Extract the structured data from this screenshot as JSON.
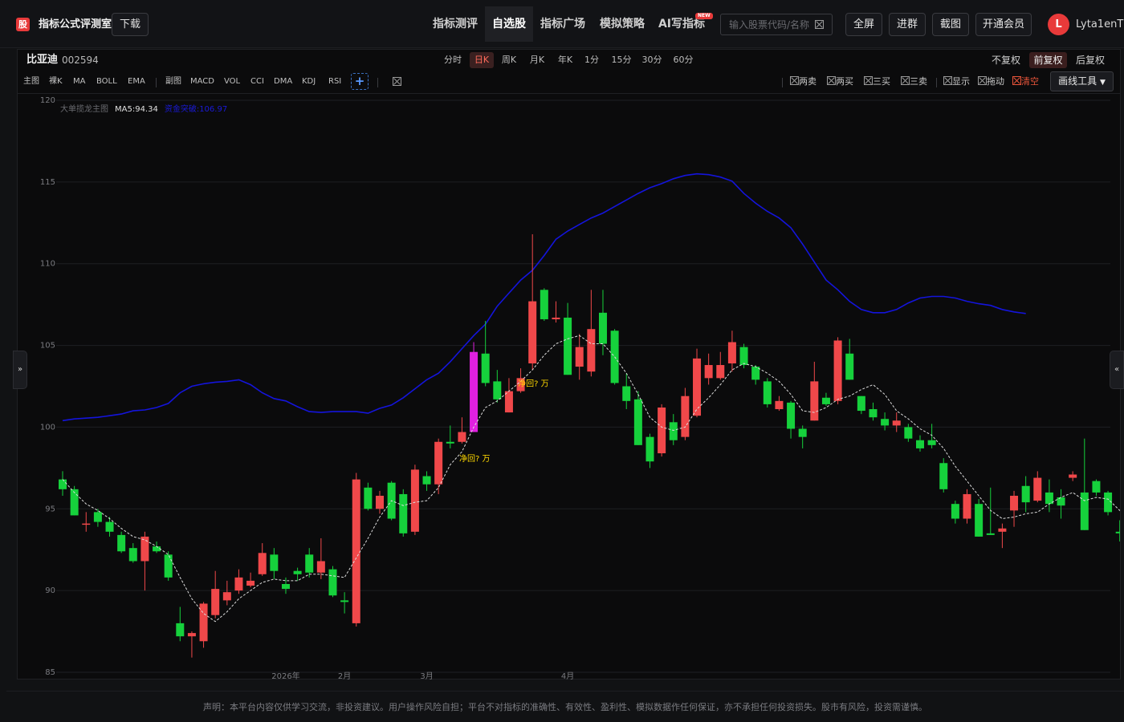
{
  "header": {
    "logo_glyph": "股",
    "brand": "指标公式评测室",
    "download_label": "下载",
    "nav": [
      {
        "label": "指标测评",
        "active": false
      },
      {
        "label": "自选股",
        "active": true
      },
      {
        "label": "指标广场",
        "active": false
      },
      {
        "label": "模拟策略",
        "active": false
      },
      {
        "label": "AI写指标",
        "active": false
      }
    ],
    "new_badge": "NEW",
    "search_placeholder": "输入股票代码/名称",
    "buttons": [
      "全屏",
      "进群",
      "截图",
      "开通会员"
    ],
    "avatar_letter": "L",
    "username": "Lyta1enT"
  },
  "stock": {
    "name": "比亚迪",
    "code": "002594"
  },
  "periods": [
    {
      "label": "分时",
      "active": false
    },
    {
      "label": "日K",
      "active": true
    },
    {
      "label": "周K",
      "active": false
    },
    {
      "label": "月K",
      "active": false
    },
    {
      "label": "年K",
      "active": false
    },
    {
      "label": "1分",
      "active": false
    },
    {
      "label": "15分",
      "active": false
    },
    {
      "label": "30分",
      "active": false
    },
    {
      "label": "60分",
      "active": false
    }
  ],
  "adjust": [
    {
      "label": "不复权",
      "active": false
    },
    {
      "label": "前复权",
      "active": true
    },
    {
      "label": "后复权",
      "active": false
    }
  ],
  "indicators": {
    "main_label": "主图",
    "main": [
      "裸K",
      "MA",
      "BOLL",
      "EMA"
    ],
    "sub_label": "副图",
    "sub": [
      "MACD",
      "VOL",
      "CCI",
      "DMA",
      "KDJ",
      "RSI"
    ],
    "add_label": "+"
  },
  "tools": [
    {
      "label": "两卖",
      "red": false
    },
    {
      "label": "两买",
      "red": false
    },
    {
      "label": "三买",
      "red": false
    },
    {
      "label": "三卖",
      "red": false
    },
    {
      "label": "显示",
      "red": false
    },
    {
      "label": "拖动",
      "red": false
    },
    {
      "label": "清空",
      "red": true
    }
  ],
  "draw_tools_label": "画线工具",
  "side_left": "»",
  "side_right": "«",
  "footer": "声明：本平台内容仅供学习交流，非投资建议。用户操作风险自担；平台不对指标的准确性、有效性、盈利性、模拟数据作任何保证，亦不承担任何投资损失。股市有风险，投资需谨慎。",
  "chart_data": {
    "type": "candlestick",
    "legend": [
      {
        "text": "大单揽龙主图",
        "color": "#6a6b70"
      },
      {
        "text": "MA5:94.34",
        "color": "#e0e0e0"
      },
      {
        "text": "资金突破:106.97",
        "color": "#1a1ad8"
      }
    ],
    "ylim": [
      85,
      120
    ],
    "y_ticks": [
      85,
      90,
      95,
      100,
      105,
      110,
      115,
      120
    ],
    "x_tick_labels": [
      {
        "label": "2026年",
        "index": 19
      },
      {
        "label": "2月",
        "index": 24
      },
      {
        "label": "3月",
        "index": 31
      },
      {
        "label": "4月",
        "index": 43
      }
    ],
    "up_color": "#f0484a",
    "down_color": "#16d13c",
    "highlight_color": "#e020e0",
    "resistance_color": "#1414dc",
    "ma_color": "#dcdcdc",
    "candles": [
      [
        96.8,
        96.2,
        97.3,
        95.8
      ],
      [
        96.2,
        94.6,
        96.4,
        94.6
      ],
      [
        94.1,
        94.1,
        94.8,
        93.6
      ],
      [
        94.8,
        94.2,
        95.0,
        93.9
      ],
      [
        94.2,
        93.6,
        94.5,
        93.3
      ],
      [
        93.4,
        92.4,
        93.6,
        92.3
      ],
      [
        92.6,
        91.8,
        92.9,
        91.7
      ],
      [
        91.8,
        93.3,
        93.6,
        90.0
      ],
      [
        92.7,
        92.4,
        93.0,
        92.3
      ],
      [
        92.2,
        90.8,
        92.4,
        90.6
      ],
      [
        88.0,
        87.2,
        89.0,
        86.9
      ],
      [
        87.2,
        87.4,
        87.5,
        85.9
      ],
      [
        86.9,
        89.2,
        89.3,
        86.5
      ],
      [
        88.5,
        90.1,
        91.2,
        88.3
      ],
      [
        89.4,
        89.9,
        90.6,
        89.1
      ],
      [
        90.0,
        90.8,
        91.3,
        89.8
      ],
      [
        90.3,
        90.6,
        91.1,
        90.2
      ],
      [
        91.0,
        92.3,
        92.9,
        90.9
      ],
      [
        92.2,
        91.2,
        92.6,
        90.7
      ],
      [
        90.4,
        90.1,
        90.8,
        89.8
      ],
      [
        91.2,
        91.0,
        91.4,
        90.6
      ],
      [
        92.2,
        91.1,
        92.6,
        90.8
      ],
      [
        91.1,
        91.8,
        93.2,
        90.7
      ],
      [
        91.3,
        89.7,
        91.5,
        89.6
      ],
      [
        89.4,
        89.3,
        89.9,
        88.6
      ],
      [
        88.0,
        96.8,
        97.2,
        87.8
      ],
      [
        96.3,
        95.0,
        96.6,
        94.9
      ],
      [
        95.0,
        95.8,
        96.1,
        94.7
      ],
      [
        96.6,
        94.4,
        96.7,
        94.3
      ],
      [
        95.9,
        93.5,
        96.2,
        93.3
      ],
      [
        93.6,
        97.4,
        97.7,
        93.4
      ],
      [
        97.0,
        96.5,
        97.3,
        96.1
      ],
      [
        96.5,
        99.1,
        99.3,
        95.9
      ],
      [
        99.1,
        99.0,
        100.1,
        98.7
      ],
      [
        99.1,
        99.7,
        100.6,
        99.0
      ],
      [
        99.7,
        104.6,
        105.2,
        99.7
      ],
      [
        104.5,
        102.7,
        106.5,
        102.5
      ],
      [
        102.8,
        101.7,
        103.5,
        101.5
      ],
      [
        100.9,
        102.2,
        103.0,
        100.9
      ],
      [
        102.2,
        103.0,
        103.6,
        102.1
      ],
      [
        103.9,
        107.7,
        111.8,
        103.5
      ],
      [
        108.4,
        106.6,
        108.5,
        106.5
      ],
      [
        106.6,
        106.7,
        107.7,
        106.4
      ],
      [
        106.7,
        103.2,
        107.6,
        103.2
      ],
      [
        103.7,
        104.9,
        105.7,
        102.9
      ],
      [
        103.4,
        106.0,
        108.4,
        103.1
      ],
      [
        107.0,
        105.1,
        108.4,
        104.4
      ],
      [
        105.9,
        102.7,
        106.0,
        102.6
      ],
      [
        102.5,
        101.6,
        103.3,
        101.1
      ],
      [
        101.7,
        98.9,
        102.2,
        98.9
      ],
      [
        99.4,
        97.9,
        99.6,
        97.5
      ],
      [
        98.4,
        101.2,
        101.4,
        98.2
      ],
      [
        100.3,
        99.2,
        100.8,
        98.9
      ],
      [
        99.4,
        101.9,
        102.4,
        99.2
      ],
      [
        100.7,
        104.2,
        104.8,
        100.6
      ],
      [
        103.0,
        103.8,
        104.5,
        102.6
      ],
      [
        103.0,
        103.8,
        104.6,
        102.9
      ],
      [
        103.9,
        105.2,
        105.9,
        103.4
      ],
      [
        104.9,
        103.8,
        105.1,
        103.6
      ],
      [
        103.7,
        102.9,
        103.8,
        102.6
      ],
      [
        102.8,
        101.4,
        103.0,
        101.2
      ],
      [
        101.1,
        101.6,
        101.9,
        101.0
      ],
      [
        101.5,
        99.9,
        101.6,
        99.3
      ],
      [
        99.9,
        99.4,
        100.1,
        98.7
      ],
      [
        100.4,
        102.8,
        104.0,
        100.4
      ],
      [
        101.8,
        101.4,
        102.1,
        101.3
      ],
      [
        101.6,
        105.3,
        105.5,
        101.4
      ],
      [
        104.5,
        102.9,
        105.4,
        102.9
      ],
      [
        101.9,
        101.0,
        101.9,
        100.8
      ],
      [
        101.1,
        100.6,
        101.5,
        100.4
      ],
      [
        100.5,
        100.1,
        100.9,
        99.8
      ],
      [
        100.1,
        100.4,
        100.9,
        99.7
      ],
      [
        100.0,
        99.3,
        100.2,
        99.1
      ],
      [
        99.2,
        98.7,
        99.5,
        98.5
      ],
      [
        99.2,
        98.9,
        100.2,
        98.7
      ],
      [
        97.8,
        96.2,
        98.1,
        96.0
      ],
      [
        95.3,
        94.4,
        95.5,
        94.1
      ],
      [
        94.4,
        95.9,
        96.2,
        94.1
      ],
      [
        95.3,
        93.3,
        95.6,
        93.3
      ],
      [
        93.5,
        93.4,
        96.3,
        93.4
      ],
      [
        93.6,
        93.8,
        94.1,
        92.6
      ],
      [
        94.9,
        95.8,
        96.1,
        93.9
      ],
      [
        96.4,
        95.4,
        97.0,
        94.8
      ],
      [
        95.5,
        96.9,
        97.3,
        95.4
      ],
      [
        96.0,
        95.3,
        96.8,
        94.8
      ],
      [
        95.7,
        95.2,
        96.2,
        94.4
      ],
      [
        96.9,
        97.1,
        97.3,
        96.7
      ],
      [
        96.0,
        93.7,
        99.3,
        93.7
      ],
      [
        96.7,
        96.0,
        96.8,
        95.8
      ],
      [
        96.0,
        94.8,
        96.1,
        94.6
      ],
      [
        93.6,
        93.5,
        94.3,
        93.0
      ],
      [
        93.6,
        93.1,
        94.5,
        92.6
      ]
    ],
    "highlight_index": 35,
    "ma5": [
      96.8,
      96.0,
      95.3,
      94.9,
      94.4,
      93.8,
      93.3,
      93.1,
      92.7,
      92.2,
      90.8,
      89.5,
      88.6,
      88.1,
      88.7,
      89.5,
      90.0,
      90.5,
      90.7,
      90.6,
      90.6,
      91.0,
      91.0,
      90.9,
      90.8,
      92.0,
      93.2,
      94.5,
      95.5,
      95.2,
      95.4,
      95.5,
      96.3,
      97.7,
      98.5,
      100.0,
      101.2,
      101.6,
      102.2,
      102.8,
      103.5,
      104.4,
      105.1,
      105.4,
      105.6,
      105.1,
      105.1,
      104.3,
      103.3,
      102.0,
      100.6,
      100.0,
      99.8,
      100.0,
      101.1,
      101.8,
      102.6,
      103.5,
      103.9,
      103.7,
      103.3,
      102.8,
      102.0,
      101.0,
      100.9,
      101.2,
      101.7,
      101.9,
      102.3,
      102.6,
      102.0,
      101.0,
      100.5,
      99.9,
      99.5,
      98.7,
      97.6,
      96.7,
      95.8,
      94.9,
      94.4,
      94.5,
      94.7,
      94.8,
      95.3,
      95.7,
      96.0,
      95.5,
      95.7,
      95.6,
      94.9,
      94.3
    ],
    "resistance": [
      100.4,
      100.5,
      100.55,
      100.6,
      100.7,
      100.8,
      101.0,
      101.05,
      101.2,
      101.45,
      102.1,
      102.5,
      102.65,
      102.75,
      102.8,
      102.9,
      102.6,
      102.1,
      101.75,
      101.6,
      101.25,
      100.95,
      100.9,
      100.95,
      100.95,
      100.95,
      100.85,
      101.15,
      101.35,
      101.8,
      102.35,
      102.9,
      103.3,
      104.0,
      104.8,
      105.6,
      106.3,
      107.4,
      108.2,
      109.0,
      109.6,
      110.5,
      111.5,
      112.0,
      112.4,
      112.8,
      113.1,
      113.5,
      113.9,
      114.3,
      114.65,
      114.9,
      115.2,
      115.4,
      115.5,
      115.45,
      115.3,
      115.05,
      114.3,
      113.7,
      113.2,
      112.8,
      112.2,
      111.2,
      110.1,
      109.0,
      108.4,
      107.7,
      107.2,
      107.0,
      107.0,
      107.2,
      107.6,
      107.9,
      108.0,
      108.0,
      107.9,
      107.7,
      107.55,
      107.45,
      107.2,
      107.05,
      106.95
    ],
    "annotations": [
      {
        "text": "净回? 万",
        "index": 35,
        "y": 98.1,
        "color": "#ffd800"
      },
      {
        "text": "净回? 万",
        "index": 40,
        "y": 102.7,
        "color": "#ffd800"
      }
    ]
  }
}
